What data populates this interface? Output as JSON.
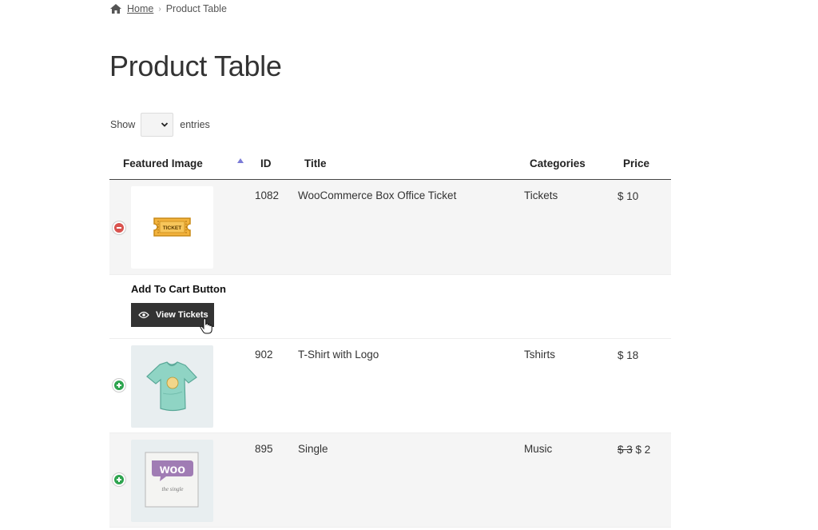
{
  "breadcrumb": {
    "home_icon": "home-icon",
    "home_label": "Home",
    "current": "Product Table"
  },
  "page": {
    "title": "Product Table"
  },
  "show_entries": {
    "before": "Show",
    "selected": "",
    "after": "entries"
  },
  "table": {
    "columns": [
      "Featured Image",
      "ID",
      "Title",
      "Categories",
      "Price"
    ],
    "sort_column": "Featured Image",
    "rows": [
      {
        "id": "1082",
        "title": "WooCommerce Box Office Ticket",
        "category": "Tickets",
        "price": "$ 10",
        "expanded": true,
        "image_icon": "ticket-icon",
        "image_text": "TICKET",
        "child": {
          "label": "Add To Cart Button",
          "button": "View Tickets",
          "button_icon": "eye-icon"
        }
      },
      {
        "id": "902",
        "title": "T-Shirt with Logo",
        "category": "Tshirts",
        "price": "$ 18",
        "expanded": false,
        "image_icon": "tshirt-icon"
      },
      {
        "id": "895",
        "title": "Single",
        "category": "Music",
        "price_old": "$ 3",
        "price": "$ 2",
        "expanded": false,
        "image_icon": "album-cover-icon",
        "image_text": "woo",
        "image_subtext": "the single"
      }
    ]
  },
  "colors": {
    "button_bg": "#333333",
    "toggle_minus": "#d9534f",
    "toggle_plus": "#2ea44f",
    "row_shade": "#f5f5f5"
  }
}
